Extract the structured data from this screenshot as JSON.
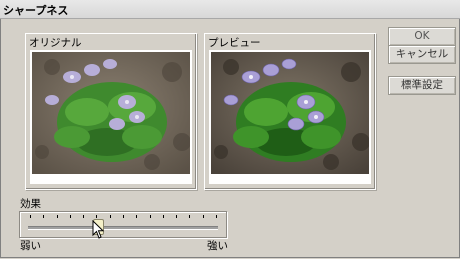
{
  "window": {
    "title": "シャープネス"
  },
  "panels": {
    "original_label": "オリジナル",
    "preview_label": "プレビュー"
  },
  "buttons": {
    "ok": "OK",
    "cancel": "キャンセル",
    "default_settings": "標準設定"
  },
  "effect": {
    "label": "効果",
    "min_label": "弱い",
    "max_label": "強い",
    "value_fraction": 0.36,
    "tick_count": 15
  },
  "icons": {
    "cursor": "mouse-pointer-icon"
  },
  "colors": {
    "dialog_bg": "#d4d0c8",
    "thumb": "#f4f0c8"
  }
}
